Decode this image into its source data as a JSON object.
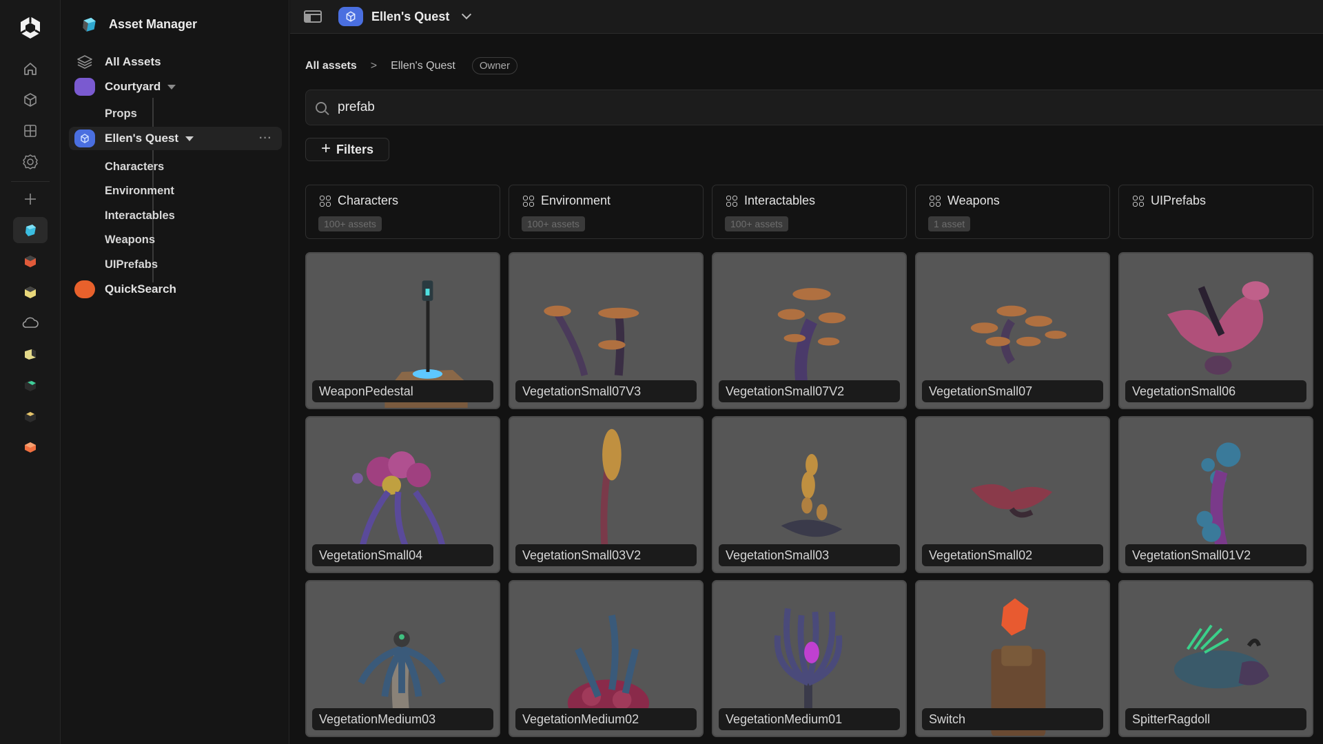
{
  "rail": {
    "items": [
      {
        "name": "home",
        "icon": "home-icon"
      },
      {
        "name": "assets",
        "icon": "cube-icon"
      },
      {
        "name": "grid",
        "icon": "grid-icon"
      },
      {
        "name": "settings",
        "icon": "gear-icon"
      },
      {
        "name": "add",
        "icon": "plus-icon"
      },
      {
        "name": "asset-manager",
        "icon": "asset-manager-app-icon",
        "color": "#3bbde0",
        "active": true
      },
      {
        "name": "app-red",
        "icon": "app-cube-red-icon",
        "color": "#e05a3a"
      },
      {
        "name": "app-yellow",
        "icon": "app-cube-yellow-icon",
        "color": "#e8d77a"
      },
      {
        "name": "cloud",
        "icon": "cloud-icon"
      },
      {
        "name": "app-yellow-2",
        "icon": "app-cube-pale-yellow-icon",
        "color": "#e3d98a"
      },
      {
        "name": "app-green",
        "icon": "app-cube-green-icon",
        "color": "#3fcf9a"
      },
      {
        "name": "app-dark-yellow",
        "icon": "app-cube-dark-icon",
        "color": "#e6c46a"
      },
      {
        "name": "app-orange",
        "icon": "app-cube-orange-icon",
        "color": "#f07040"
      }
    ]
  },
  "sidebar": {
    "title": "Asset Manager",
    "all_assets": "All Assets",
    "projects": [
      {
        "label": "Courtyard",
        "color": "#7a5ad0",
        "children": [
          "Props"
        ]
      },
      {
        "label": "Ellen's Quest",
        "color": "#4a6fe0",
        "active": true,
        "more": "···",
        "children": [
          "Characters",
          "Environment",
          "Interactables",
          "Weapons",
          "UIPrefabs"
        ]
      },
      {
        "label": "QuickSearch",
        "color": "#e8612c",
        "children": []
      }
    ]
  },
  "header": {
    "project": "Ellen's Quest"
  },
  "breadcrumb": {
    "root": "All assets",
    "separator": ">",
    "current": "Ellen's Quest",
    "role_badge": "Owner"
  },
  "search": {
    "value": "prefab",
    "placeholder": "Search"
  },
  "filters_label": "Filters",
  "collections": [
    {
      "label": "Characters",
      "count": "100+ assets"
    },
    {
      "label": "Environment",
      "count": "100+ assets"
    },
    {
      "label": "Interactables",
      "count": "100+ assets"
    },
    {
      "label": "Weapons",
      "count": "1 asset"
    },
    {
      "label": "UIPrefabs",
      "count": ""
    }
  ],
  "assets": [
    {
      "name": "WeaponPedestal",
      "thumb": "pedestal"
    },
    {
      "name": "VegetationSmall07V3",
      "thumb": "mushroom-orange"
    },
    {
      "name": "VegetationSmall07V2",
      "thumb": "mushroom-cluster"
    },
    {
      "name": "VegetationSmall07",
      "thumb": "mushroom-spread"
    },
    {
      "name": "VegetationSmall06",
      "thumb": "pink-flower"
    },
    {
      "name": "VegetationSmall04",
      "thumb": "purple-bulbs"
    },
    {
      "name": "VegetationSmall03V2",
      "thumb": "yellow-stalk"
    },
    {
      "name": "VegetationSmall03",
      "thumb": "yellow-buds"
    },
    {
      "name": "VegetationSmall02",
      "thumb": "red-leaf"
    },
    {
      "name": "VegetationSmall01V2",
      "thumb": "blue-bulbs"
    },
    {
      "name": "VegetationMedium03",
      "thumb": "blue-palm"
    },
    {
      "name": "VegetationMedium02",
      "thumb": "coral-plant"
    },
    {
      "name": "VegetationMedium01",
      "thumb": "glowing-flower"
    },
    {
      "name": "Switch",
      "thumb": "crystal-switch"
    },
    {
      "name": "SpitterRagdoll",
      "thumb": "creature"
    }
  ]
}
